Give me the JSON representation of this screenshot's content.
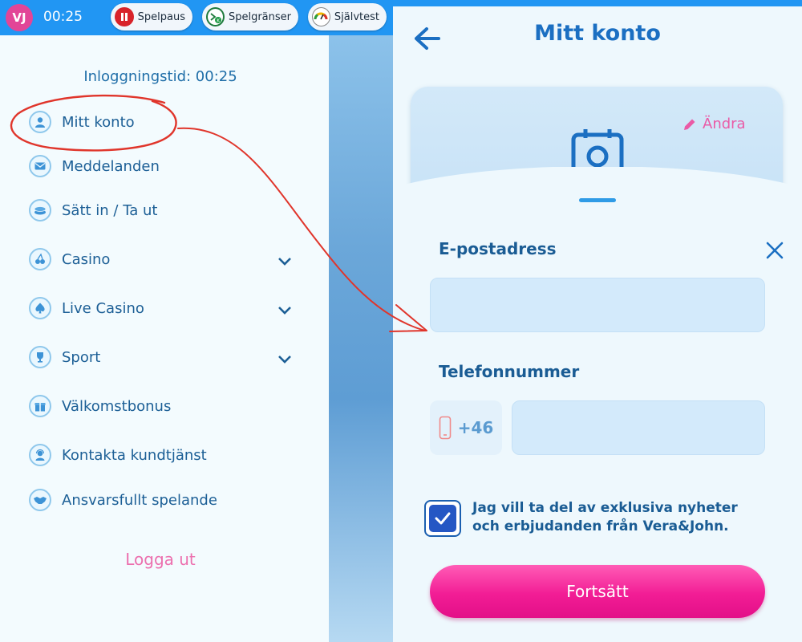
{
  "topbar": {
    "logo_text": "VJ",
    "timer": "00:25",
    "pills": [
      {
        "label": "Spelpaus",
        "icon": "pause-icon"
      },
      {
        "label": "Spelgränser",
        "icon": "limits-icon"
      },
      {
        "label": "Självtest",
        "icon": "gauge-icon"
      }
    ]
  },
  "menu": {
    "login_time": "Inloggningstid: 00:25",
    "items": [
      {
        "label": "Mitt konto",
        "icon": "user-icon",
        "expandable": false
      },
      {
        "label": "Meddelanden",
        "icon": "mail-icon",
        "expandable": false
      },
      {
        "label": "Sätt in / Ta ut",
        "icon": "coins-icon",
        "expandable": false
      },
      {
        "label": "Casino",
        "icon": "cherries-icon",
        "expandable": true
      },
      {
        "label": "Live Casino",
        "icon": "spade-icon",
        "expandable": true
      },
      {
        "label": "Sport",
        "icon": "trophy-icon",
        "expandable": true
      },
      {
        "label": "Välkomstbonus",
        "icon": "gift-icon",
        "expandable": false
      },
      {
        "label": "Kontakta kundtjänst",
        "icon": "support-agent-icon",
        "expandable": false
      },
      {
        "label": "Ansvarsfullt spelande",
        "icon": "handshake-icon",
        "expandable": false
      }
    ],
    "logout": "Logga ut"
  },
  "account": {
    "title": "Mitt konto",
    "edit_label": "Ändra",
    "email_label": "E-postadress",
    "email_value": "",
    "phone_label": "Telefonnummer",
    "phone_prefix": "+46",
    "phone_value": "",
    "consent_checked": true,
    "consent_text": "Jag vill ta del av exklusiva nyheter och erbjudanden från Vera&John.",
    "continue_label": "Fortsätt"
  },
  "colors": {
    "topbar": "#2196f3",
    "menu_text": "#1c5f96",
    "title": "#1b6fc2",
    "accent_pink": "#ea5aa6",
    "annotation_red": "#e0352b"
  }
}
